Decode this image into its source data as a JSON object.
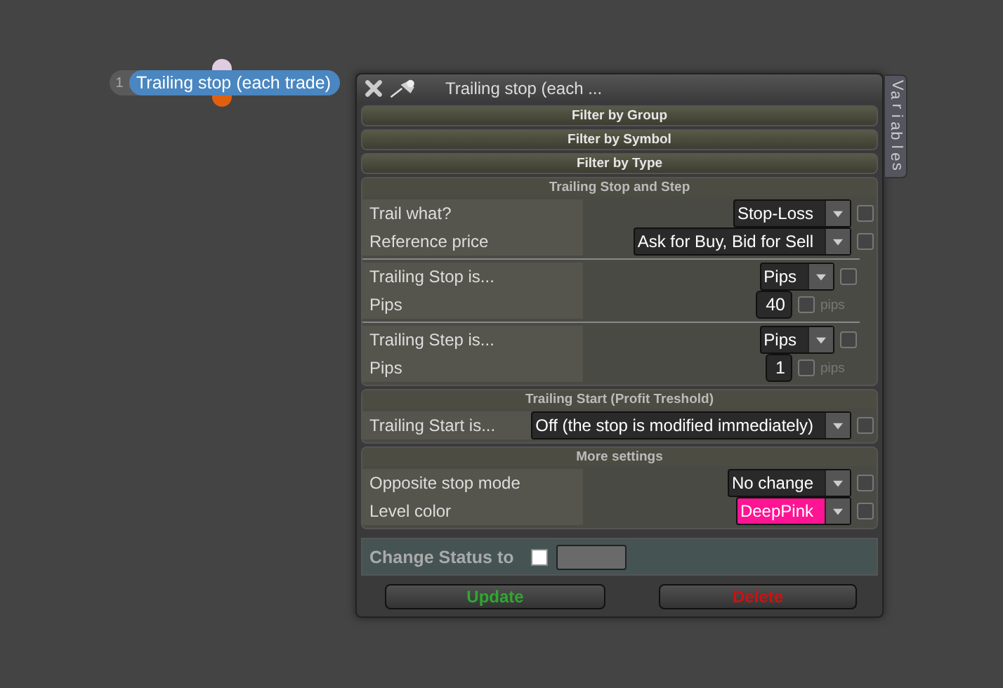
{
  "node": {
    "index": "1",
    "label": "Trailing stop (each trade)"
  },
  "panel": {
    "title": "Trailing stop (each ...",
    "side_tab": "Variables",
    "sections": [
      {
        "title": "Filter by Group",
        "expanded": false
      },
      {
        "title": "Filter by Symbol",
        "expanded": false
      },
      {
        "title": "Filter by Type",
        "expanded": false
      },
      {
        "title": "Trailing Stop and Step",
        "expanded": true,
        "groups": [
          [
            {
              "label": "Trail what?",
              "kind": "dropdown",
              "value": "Stop-Loss",
              "checked": false
            },
            {
              "label": "Reference price",
              "kind": "dropdown",
              "value": "Ask for Buy, Bid for Sell",
              "checked": false
            }
          ],
          [
            {
              "label": "Trailing Stop is...",
              "kind": "dropdown",
              "value": "Pips",
              "checked": false
            },
            {
              "label": "Pips",
              "kind": "number",
              "value": "40",
              "checked": false,
              "unit": "pips"
            }
          ],
          [
            {
              "label": "Trailing Step is...",
              "kind": "dropdown",
              "value": "Pips",
              "checked": false
            },
            {
              "label": "Pips",
              "kind": "number",
              "value": "1",
              "checked": false,
              "unit": "pips"
            }
          ]
        ]
      },
      {
        "title": "Trailing Start (Profit Treshold)",
        "expanded": true,
        "groups": [
          [
            {
              "label": "Trailing Start is...",
              "kind": "dropdown",
              "value": "Off (the stop is modified immediately)",
              "checked": false
            }
          ]
        ]
      },
      {
        "title": "More settings",
        "expanded": true,
        "groups": [
          [
            {
              "label": "Opposite stop mode",
              "kind": "dropdown",
              "value": "No change",
              "checked": false
            },
            {
              "label": "Level color",
              "kind": "dropdown",
              "value": "DeepPink",
              "checked": false,
              "color": "#ff1493"
            }
          ]
        ]
      }
    ],
    "status": {
      "label": "Change Status to",
      "checked": false
    },
    "buttons": [
      {
        "label": "Update",
        "color": "#2ea82e"
      },
      {
        "label": "Delete",
        "color": "#d01010"
      }
    ]
  }
}
